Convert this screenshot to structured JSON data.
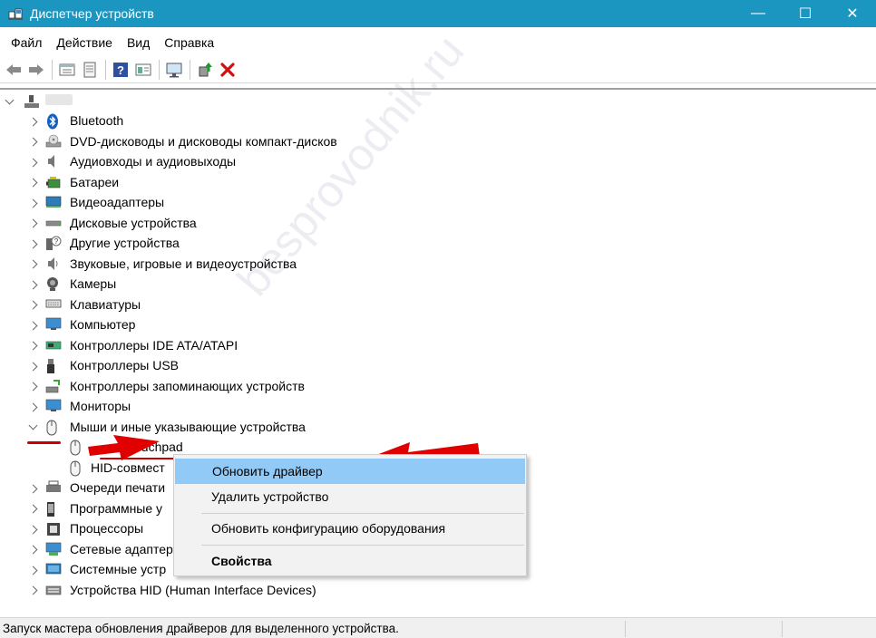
{
  "window": {
    "title": "Диспетчер устройств",
    "minimize": "—",
    "maximize": "☐",
    "close": "✕"
  },
  "menu": [
    "Файл",
    "Действие",
    "Вид",
    "Справка"
  ],
  "toolbar": [
    "back-icon",
    "forward-icon",
    "properties-view-icon",
    "show-hidden-icon",
    "help-icon",
    "details-icon",
    "monitor-icon",
    "update-driver-icon",
    "uninstall-icon"
  ],
  "tree": {
    "root_label": "",
    "categories": [
      {
        "label": "Bluetooth",
        "icon": "bluetooth-icon",
        "expanded": false
      },
      {
        "label": "DVD-дисководы и дисководы компакт-дисков",
        "icon": "dvd-icon",
        "expanded": false
      },
      {
        "label": "Аудиовходы и аудиовыходы",
        "icon": "speaker-icon",
        "expanded": false
      },
      {
        "label": "Батареи",
        "icon": "battery-icon",
        "expanded": false
      },
      {
        "label": "Видеоадаптеры",
        "icon": "display-adapter-icon",
        "expanded": false
      },
      {
        "label": "Дисковые устройства",
        "icon": "disk-icon",
        "expanded": false
      },
      {
        "label": "Другие устройства",
        "icon": "unknown-device-icon",
        "expanded": false
      },
      {
        "label": "Звуковые, игровые и видеоустройства",
        "icon": "sound-icon",
        "expanded": false
      },
      {
        "label": "Камеры",
        "icon": "camera-icon",
        "expanded": false
      },
      {
        "label": "Клавиатуры",
        "icon": "keyboard-icon",
        "expanded": false
      },
      {
        "label": "Компьютер",
        "icon": "computer-icon",
        "expanded": false
      },
      {
        "label": "Контроллеры IDE ATA/ATAPI",
        "icon": "ide-icon",
        "expanded": false
      },
      {
        "label": "Контроллеры USB",
        "icon": "usb-icon",
        "expanded": false
      },
      {
        "label": "Контроллеры запоминающих устройств",
        "icon": "storage-icon",
        "expanded": false
      },
      {
        "label": "Мониторы",
        "icon": "monitor-icon",
        "expanded": false
      },
      {
        "label": "Мыши и иные указывающие устройства",
        "icon": "mouse-icon",
        "expanded": true
      },
      {
        "label": "Touchpad",
        "icon": "mouse-icon",
        "child": true
      },
      {
        "label": "HID-совмест",
        "icon": "mouse-icon",
        "child": true
      },
      {
        "label": "Очереди печати",
        "icon": "printer-icon",
        "expanded": false
      },
      {
        "label": "Программные у",
        "icon": "software-device-icon",
        "expanded": false
      },
      {
        "label": "Процессоры",
        "icon": "cpu-icon",
        "expanded": false
      },
      {
        "label": "Сетевые адаптер",
        "icon": "network-icon",
        "expanded": false
      },
      {
        "label": "Системные устр",
        "icon": "system-icon",
        "expanded": false
      },
      {
        "label": "Устройства HID (Human Interface Devices)",
        "icon": "hid-icon",
        "expanded": false
      }
    ]
  },
  "context_menu": {
    "update_driver": "Обновить драйвер",
    "uninstall": "Удалить устройство",
    "scan": "Обновить конфигурацию оборудования",
    "properties": "Свойства"
  },
  "status": "Запуск мастера обновления драйверов для выделенного устройства.",
  "watermark": "besprovodnik.ru",
  "colors": {
    "titlebar": "#1a96c0",
    "highlight": "#91c9f7",
    "annotation": "#e00000"
  }
}
